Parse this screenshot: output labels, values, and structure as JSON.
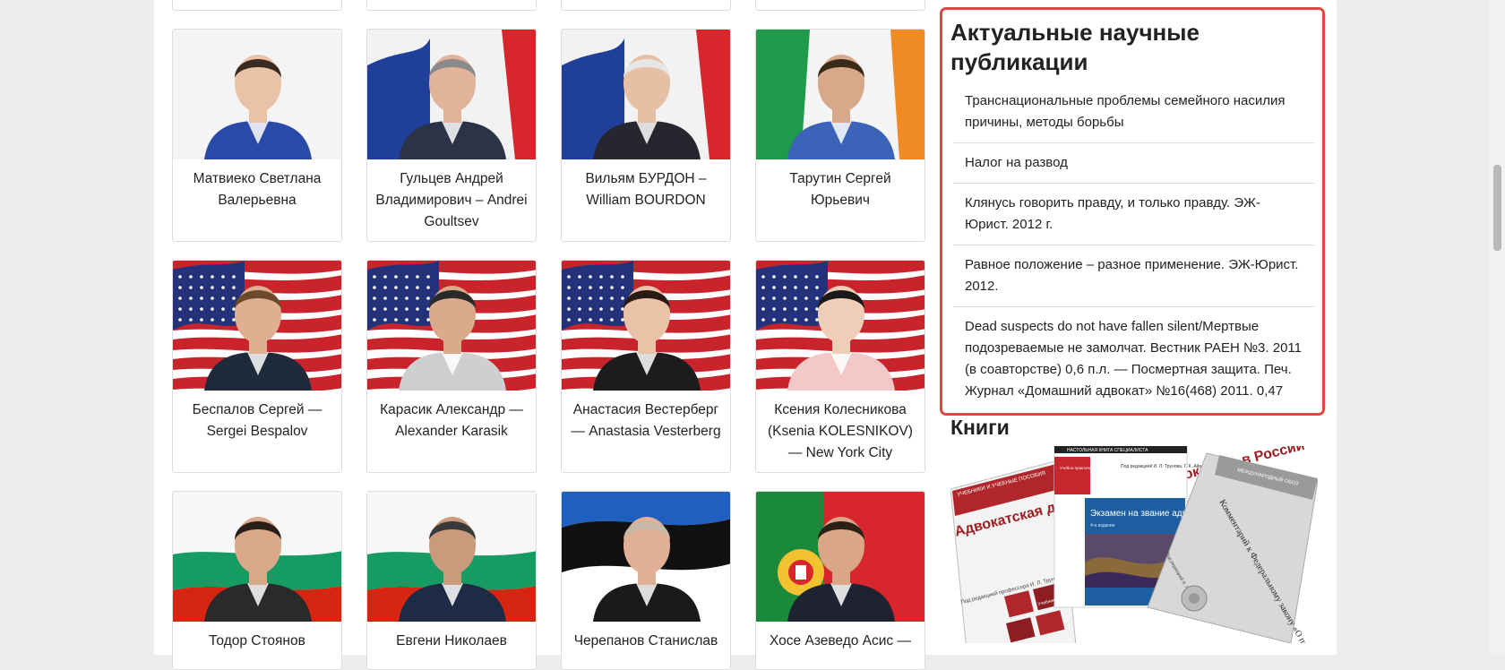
{
  "people": [
    {
      "name": "Матвиеко Светлана Валерьевна",
      "flag": "none",
      "suit": "#2a4aa8",
      "skin": "#e9c3a8",
      "hair": "#3a2a20"
    },
    {
      "name": "Гульцев Андрей Владимирович – Andrei Goultsev",
      "flag": "france",
      "suit": "#2b3346",
      "skin": "#e0b49a",
      "hair": "#8a8a8a"
    },
    {
      "name": "Вильям БУРДОН – William BOURDON",
      "flag": "france",
      "suit": "#26262e",
      "skin": "#e6c0a5",
      "hair": "#e6e6e6"
    },
    {
      "name": "Тарутин Сергей Юрьевич",
      "flag": "ireland",
      "suit": "#3b63b8",
      "skin": "#d9a88a",
      "hair": "#3a2a1a"
    },
    {
      "name": "Беспалов Сергей — Sergei Bespalov",
      "flag": "usa",
      "suit": "#1f2a3a",
      "skin": "#e0ae90",
      "hair": "#6a4a2a"
    },
    {
      "name": "Карасик Александр — Alexander Karasik",
      "flag": "usa",
      "suit": "#cfcfcf",
      "skin": "#d9aa8c",
      "hair": "#2a2a2a"
    },
    {
      "name": "Анастасия Вестерберг — Anastasia Vesterberg",
      "flag": "usa",
      "suit": "#1c1c1c",
      "skin": "#eac2a8",
      "hair": "#2a1a14"
    },
    {
      "name": "Ксения Колесникова (Ksenia KOLESNIKOV) — New York City",
      "flag": "usa",
      "suit": "#f3c8c8",
      "skin": "#f0cdb6",
      "hair": "#1a1a1a"
    },
    {
      "name": "Тодор Стоянов",
      "flag": "bulgaria",
      "suit": "#2a2a2a",
      "skin": "#d9a888",
      "hair": "#2a1e18"
    },
    {
      "name": "Евгени Николаев",
      "flag": "bulgaria",
      "suit": "#1f2a44",
      "skin": "#c99a7c",
      "hair": "#3a3a3a"
    },
    {
      "name": "Черепанов Станислав",
      "flag": "estonia",
      "suit": "#1a1a1a",
      "skin": "#e2b096",
      "hair": "#c8b8a8"
    },
    {
      "name": "Хосе Азеведо Асис —",
      "flag": "portugal",
      "suit": "#1f2230",
      "skin": "#d9a788",
      "hair": "#2a2018"
    }
  ],
  "sidebar": {
    "pubs_title": "Актуальные научные публикации",
    "publications": [
      "Транснациональные проблемы семейного насилия причины, методы борьбы",
      "Налог на развод",
      "Клянусь говорить правду, и только правду. ЭЖ-Юрист. 2012 г.",
      "Равное положение – разное применение. ЭЖ-Юрист. 2012.",
      "Dead suspects do not have fallen silent/Мертвые подозреваемые не замолчат. Вестник РАЕН №3. 2011 (в соавторстве) 0,6 п.л. — Посмертная защита. Печ. Журнал «Домашний адвокат» №16(468) 2011. 0,47"
    ],
    "books_title": "Книги",
    "books": {
      "book1": {
        "top_label": "УЧЕБНИКИ И УЧЕБНЫЕ ПОСОБИЯ",
        "title": "Адвокатская деятельность и адвокатура в России",
        "editor": "Под редакцией профессора И. Л. Трунова",
        "badge": "Учебник 3-е издание",
        "color": "#b0262a"
      },
      "book2": {
        "top_label": "НАСТОЛЬНАЯ КНИГА СПЕЦИАЛИСТА",
        "subtitle": "Учебно-практическое пособие",
        "editor": "Под редакцией И. Л. Трунова, Г. К. Айвар",
        "title": "Экзамен на звание адвоката",
        "edition": "4-е издание",
        "color": "#1d5fa0"
      },
      "book3": {
        "top_label": "МЕЖДУНАРОДНЫЙ ОБОЗ",
        "title": "Комментарий к Федеральному закону «О полиции»",
        "editor": "Под редакцией И. Л. Трунова",
        "color": "#c9c9c9"
      }
    }
  },
  "colors": {
    "highlight_border": "#e24a40",
    "page_bg": "#ececec"
  }
}
